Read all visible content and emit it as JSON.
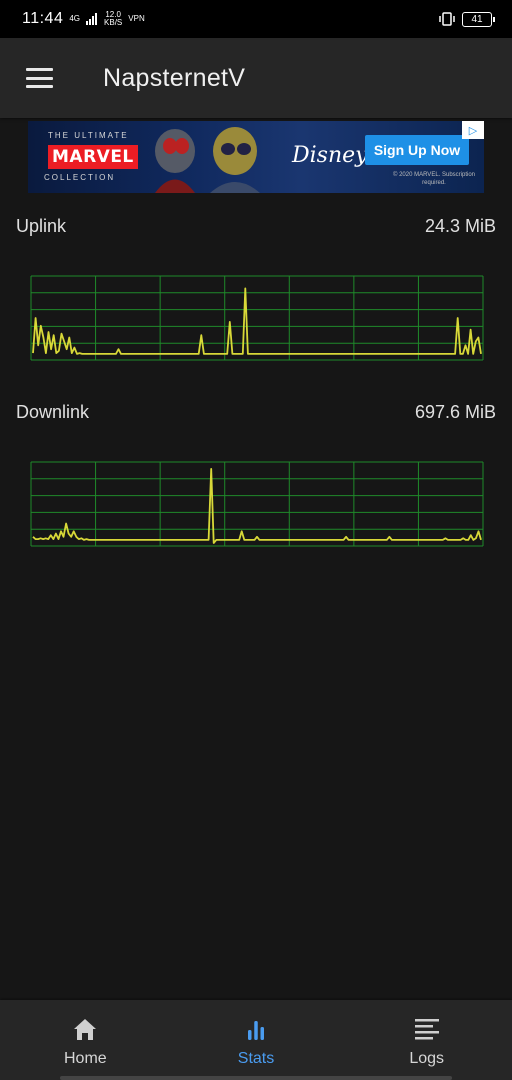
{
  "status_bar": {
    "time": "11:44",
    "network": "4G",
    "speed_value": "12.0",
    "speed_unit": "KB/S",
    "vpn": "VPN",
    "battery": "41"
  },
  "app_bar": {
    "title": "NapsternetV"
  },
  "ad": {
    "tagline_top": "THE ULTIMATE",
    "brand": "MARVEL",
    "tagline_bottom": "COLLECTION",
    "partner": "Disney+",
    "cta": "Sign Up Now",
    "fine_print": "© 2020 MARVEL. Subscription required."
  },
  "uplink": {
    "label": "Uplink",
    "value": "24.3 MiB",
    "line_color": "#d8d838",
    "grid_color": "#1f8a2a",
    "series": [
      0.05,
      0.5,
      0.15,
      0.4,
      0.25,
      0.05,
      0.32,
      0.1,
      0.28,
      0.05,
      0.08,
      0.3,
      0.2,
      0.1,
      0.25,
      0.05,
      0.12,
      0.04,
      0.05,
      0.04,
      0.04,
      0.04,
      0.04,
      0.04,
      0.04,
      0.04,
      0.04,
      0.04,
      0.04,
      0.04,
      0.04,
      0.04,
      0.04,
      0.1,
      0.04,
      0.04,
      0.04,
      0.04,
      0.04,
      0.04,
      0.04,
      0.04,
      0.04,
      0.04,
      0.04,
      0.04,
      0.04,
      0.04,
      0.04,
      0.04,
      0.04,
      0.04,
      0.04,
      0.04,
      0.04,
      0.04,
      0.04,
      0.04,
      0.04,
      0.04,
      0.04,
      0.04,
      0.04,
      0.04,
      0.04,
      0.28,
      0.04,
      0.04,
      0.04,
      0.04,
      0.04,
      0.04,
      0.04,
      0.04,
      0.04,
      0.04,
      0.45,
      0.04,
      0.04,
      0.04,
      0.04,
      0.04,
      0.88,
      0.04,
      0.04,
      0.04,
      0.04,
      0.04,
      0.04,
      0.04,
      0.04,
      0.04,
      0.04,
      0.04,
      0.04,
      0.04,
      0.04,
      0.04,
      0.04,
      0.04,
      0.04,
      0.04,
      0.04,
      0.04,
      0.04,
      0.04,
      0.04,
      0.04,
      0.04,
      0.04,
      0.04,
      0.04,
      0.04,
      0.04,
      0.04,
      0.04,
      0.04,
      0.04,
      0.04,
      0.04,
      0.04,
      0.04,
      0.04,
      0.04,
      0.04,
      0.04,
      0.04,
      0.04,
      0.04,
      0.04,
      0.04,
      0.04,
      0.04,
      0.04,
      0.04,
      0.04,
      0.04,
      0.04,
      0.04,
      0.04,
      0.04,
      0.04,
      0.04,
      0.04,
      0.04,
      0.04,
      0.04,
      0.04,
      0.04,
      0.04,
      0.04,
      0.04,
      0.04,
      0.04,
      0.04,
      0.04,
      0.04,
      0.04,
      0.04,
      0.04,
      0.04,
      0.04,
      0.04,
      0.04,
      0.5,
      0.04,
      0.04,
      0.15,
      0.04,
      0.35,
      0.04,
      0.2,
      0.25,
      0.04
    ]
  },
  "downlink": {
    "label": "Downlink",
    "value": "697.6 MiB",
    "line_color": "#d8d838",
    "grid_color": "#1f8a2a",
    "series": [
      0.08,
      0.05,
      0.05,
      0.06,
      0.05,
      0.06,
      0.05,
      0.1,
      0.05,
      0.12,
      0.05,
      0.15,
      0.08,
      0.25,
      0.12,
      0.08,
      0.15,
      0.08,
      0.05,
      0.06,
      0.04,
      0.05,
      0.04,
      0.04,
      0.04,
      0.04,
      0.04,
      0.04,
      0.04,
      0.04,
      0.04,
      0.04,
      0.04,
      0.04,
      0.04,
      0.04,
      0.04,
      0.04,
      0.04,
      0.04,
      0.04,
      0.04,
      0.04,
      0.04,
      0.04,
      0.04,
      0.04,
      0.04,
      0.04,
      0.04,
      0.04,
      0.04,
      0.04,
      0.04,
      0.04,
      0.04,
      0.04,
      0.04,
      0.04,
      0.04,
      0.04,
      0.04,
      0.04,
      0.04,
      0.04,
      0.04,
      0.04,
      0.04,
      0.04,
      0.04,
      0.95,
      0.0,
      0.04,
      0.04,
      0.04,
      0.04,
      0.04,
      0.04,
      0.04,
      0.04,
      0.04,
      0.04,
      0.15,
      0.04,
      0.04,
      0.04,
      0.04,
      0.04,
      0.08,
      0.04,
      0.04,
      0.04,
      0.04,
      0.04,
      0.04,
      0.04,
      0.04,
      0.04,
      0.04,
      0.04,
      0.04,
      0.04,
      0.04,
      0.04,
      0.04,
      0.04,
      0.04,
      0.04,
      0.04,
      0.04,
      0.04,
      0.04,
      0.04,
      0.04,
      0.04,
      0.04,
      0.04,
      0.04,
      0.04,
      0.04,
      0.04,
      0.04,
      0.04,
      0.08,
      0.04,
      0.04,
      0.04,
      0.04,
      0.04,
      0.04,
      0.04,
      0.04,
      0.04,
      0.04,
      0.04,
      0.04,
      0.04,
      0.04,
      0.04,
      0.04,
      0.08,
      0.04,
      0.04,
      0.04,
      0.04,
      0.04,
      0.04,
      0.04,
      0.04,
      0.04,
      0.04,
      0.04,
      0.04,
      0.04,
      0.04,
      0.04,
      0.04,
      0.04,
      0.04,
      0.04,
      0.04,
      0.04,
      0.06,
      0.04,
      0.04,
      0.04,
      0.04,
      0.04,
      0.04,
      0.06,
      0.04,
      0.04,
      0.1,
      0.04,
      0.06,
      0.15,
      0.04
    ]
  },
  "nav": {
    "items": [
      {
        "label": "Home",
        "icon": "home-icon",
        "active": false
      },
      {
        "label": "Stats",
        "icon": "bar-chart-icon",
        "active": true
      },
      {
        "label": "Logs",
        "icon": "list-icon",
        "active": false
      }
    ],
    "active_color": "#4a9cf0"
  }
}
